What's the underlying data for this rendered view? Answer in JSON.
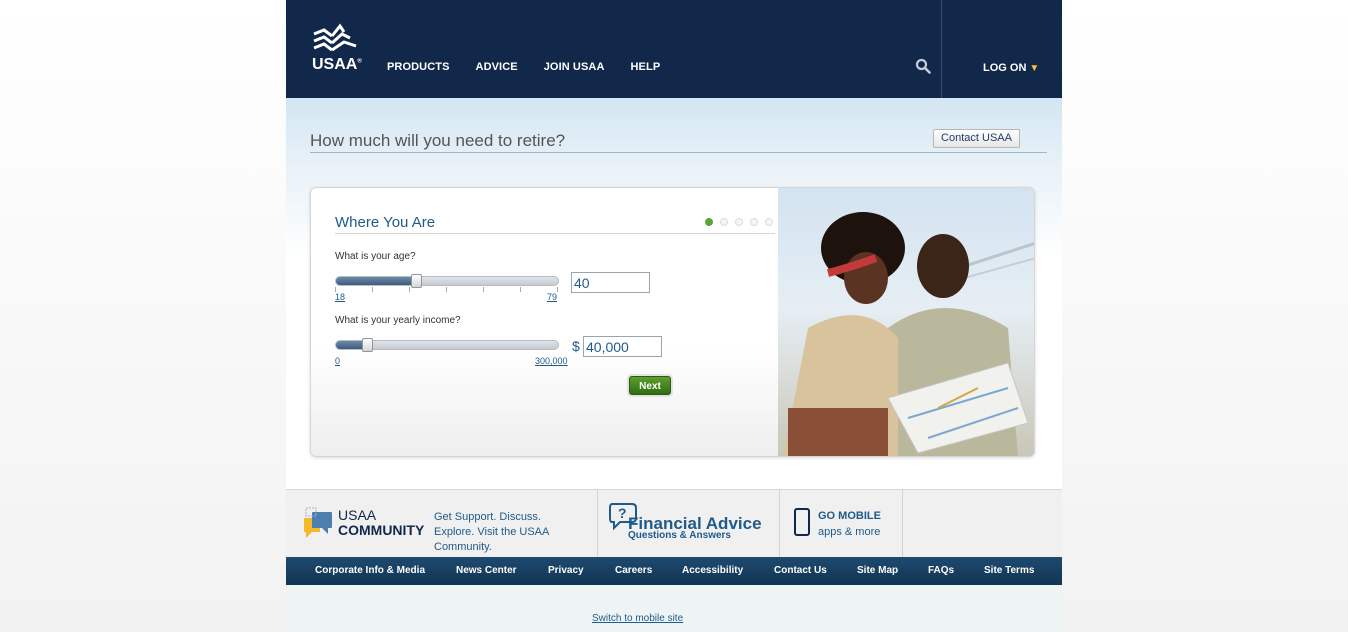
{
  "header": {
    "logo_text": "USAA",
    "nav": [
      "PRODUCTS",
      "ADVICE",
      "JOIN USAA",
      "HELP"
    ],
    "logon_label": "LOG ON"
  },
  "hero": {
    "title": "How much will you need to retire?",
    "contact_label": "Contact USAA"
  },
  "calculator": {
    "title": "Where You Are",
    "step_current": 1,
    "step_total": 5,
    "age": {
      "question": "What is your age?",
      "min_label": "18",
      "max_label": "79",
      "value": "40",
      "slider_fraction": 0.36
    },
    "income": {
      "question": "What is your yearly income?",
      "min_label": "0",
      "max_label": "300,000",
      "currency": "$",
      "value": "40,000",
      "slider_fraction": 0.14
    },
    "next_label": "Next"
  },
  "promo": {
    "community_line1": "USAA",
    "community_line2": "COMMUNITY",
    "community_text": "Get Support. Discuss. Explore. Visit the USAA Community.",
    "advice_title": "Financial Advice",
    "advice_sub": "Questions & Answers",
    "mobile_title": "GO MOBILE",
    "mobile_sub": "apps & more"
  },
  "footer": {
    "links": [
      "Corporate Info & Media",
      "News Center",
      "Privacy",
      "Careers",
      "Accessibility",
      "Contact Us",
      "Site Map",
      "FAQs",
      "Site Terms"
    ],
    "mobile_link": "Switch to mobile site"
  },
  "colors": {
    "header_bg": "#12284a",
    "accent_blue": "#1f5a8a",
    "next_green": "#4a8a22",
    "logon_chevron": "#f2c230"
  }
}
